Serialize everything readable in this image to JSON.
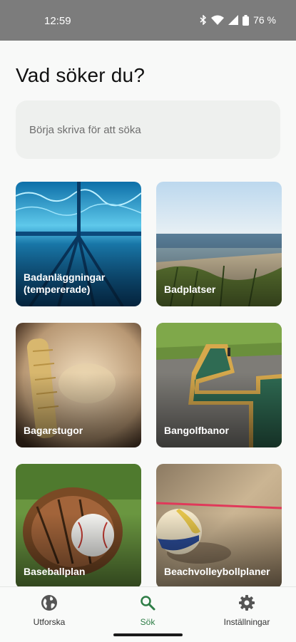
{
  "status_bar": {
    "time": "12:59",
    "battery": "76 %",
    "icons": [
      "bluetooth-icon",
      "wifi-icon",
      "signal-icon",
      "battery-icon"
    ]
  },
  "page": {
    "title": "Vad söker du?"
  },
  "search": {
    "placeholder": "Börja skriva för att söka"
  },
  "categories": [
    {
      "label": "Badanläggningar\n(tempererade)"
    },
    {
      "label": "Badplatser"
    },
    {
      "label": "Bagarstugor"
    },
    {
      "label": "Bangolfbanor"
    },
    {
      "label": "Baseballplan"
    },
    {
      "label": "Beachvolleybollplaner"
    }
  ],
  "bottom_nav": {
    "items": [
      {
        "label": "Utforska",
        "icon": "globe-icon",
        "active": false
      },
      {
        "label": "Sök",
        "icon": "search-icon",
        "active": true
      },
      {
        "label": "Inställningar",
        "icon": "gear-icon",
        "active": false
      }
    ]
  },
  "colors": {
    "accent": "#2e7d46",
    "status_bar": "#7c7c7c",
    "background": "#f8f9f8"
  }
}
